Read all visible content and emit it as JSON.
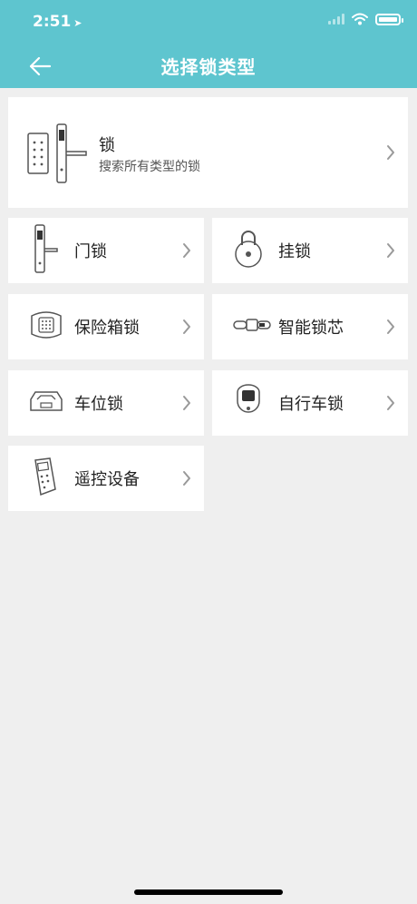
{
  "status_bar": {
    "time": "2:51"
  },
  "header": {
    "title": "选择锁类型"
  },
  "featured": {
    "title": "锁",
    "subtitle": "搜索所有类型的锁",
    "icon": "door-lock-keypad-icon"
  },
  "categories": [
    {
      "label": "门锁",
      "icon": "door-lock-icon"
    },
    {
      "label": "挂锁",
      "icon": "padlock-icon"
    },
    {
      "label": "保险箱锁",
      "icon": "safe-lock-icon"
    },
    {
      "label": "智能锁芯",
      "icon": "smart-cylinder-icon"
    },
    {
      "label": "车位锁",
      "icon": "parking-lock-icon"
    },
    {
      "label": "自行车锁",
      "icon": "bike-lock-icon"
    },
    {
      "label": "遥控设备",
      "icon": "remote-control-icon"
    }
  ],
  "colors": {
    "header": "#5ec5cf",
    "background": "#efefef",
    "card": "#ffffff"
  }
}
